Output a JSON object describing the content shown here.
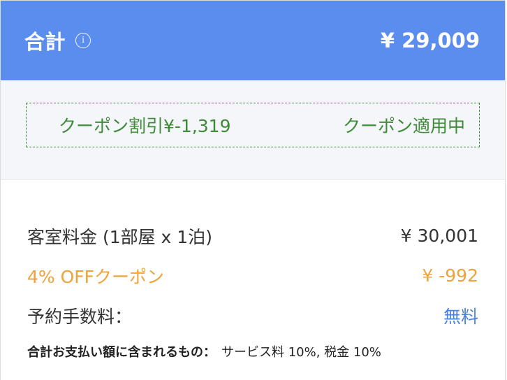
{
  "header": {
    "title": "合計",
    "info_icon_glyph": "i",
    "total": "¥ 29,009",
    "background_color": "#5b8def"
  },
  "coupon": {
    "discount_text": "クーポン割引¥-1,319",
    "status_text": "クーポン適用中",
    "color": "#3d8b37"
  },
  "breakdown": {
    "room": {
      "label": "客室料金 (1部屋 x 1泊)",
      "value": "¥ 30,001"
    },
    "discount": {
      "label": "4% OFFクーポン",
      "value": "¥ -992",
      "color": "#f0a33a"
    },
    "fee": {
      "label": "予約手数料：",
      "value": "無料",
      "color": "#4a82e0"
    },
    "note": {
      "label": "合計お支払い額に含まれるもの：",
      "value": "サービス料 10%, 税金 10%"
    }
  }
}
